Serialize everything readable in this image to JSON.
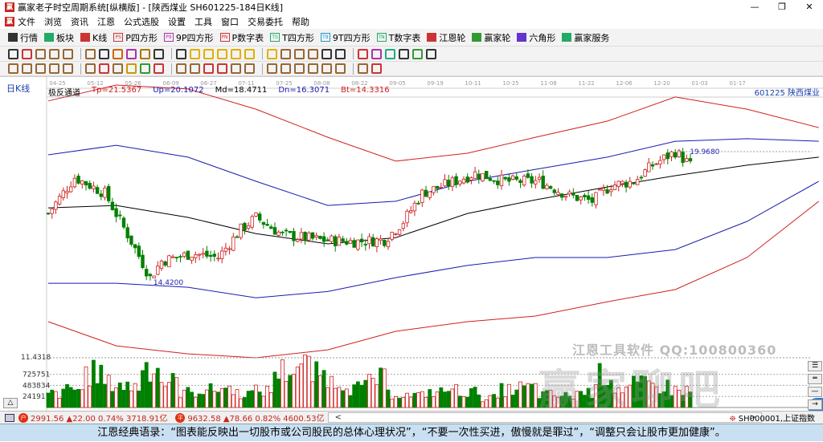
{
  "window": {
    "title": "赢家老子时空周期系统[纵横版] - [陕西煤业  SH601225-184日K线]",
    "controls": [
      "—",
      "❐",
      "✕"
    ]
  },
  "menu": [
    "文件",
    "浏览",
    "资讯",
    "江恩",
    "公式选股",
    "设置",
    "工具",
    "窗口",
    "交易委托",
    "帮助"
  ],
  "mdi_controls": [
    "_",
    "❐",
    "×"
  ],
  "toolbar": [
    {
      "label": "行情",
      "icon": "grid-icon",
      "color": "#333"
    },
    {
      "label": "板块",
      "icon": "blocks-icon",
      "color": "#2a6"
    },
    {
      "label": "K线",
      "icon": "candles-icon",
      "color": "#c33"
    },
    {
      "label": "P四方形",
      "icon": "PS",
      "color": "#c33"
    },
    {
      "label": "9P四方形",
      "icon": "P9",
      "color": "#a3a"
    },
    {
      "label": "P数字表",
      "icon": "PN",
      "color": "#c33"
    },
    {
      "label": "T四方形",
      "icon": "TS",
      "color": "#2a6"
    },
    {
      "label": "9T四方形",
      "icon": "T9",
      "color": "#29c"
    },
    {
      "label": "T数字表",
      "icon": "TN",
      "color": "#2a6"
    },
    {
      "label": "江恩轮",
      "icon": "wheel-icon",
      "color": "#c33"
    },
    {
      "label": "赢家轮",
      "icon": "wheel-icon",
      "color": "#393"
    },
    {
      "label": "六角形",
      "icon": "hexagon-icon",
      "color": "#63c"
    },
    {
      "label": "赢家服务",
      "icon": "dollar-icon",
      "color": "#2a6"
    }
  ],
  "toolbar2_colors": [
    "#333",
    "#c33",
    "#963",
    "#963",
    "#963",
    "#963",
    "#333",
    "#c60",
    "#a3a",
    "#a70",
    "#333",
    "#333",
    "#e0b000",
    "#e0b000",
    "#e0b000",
    "#e0b000",
    "#e0b000",
    "#e0b000",
    "#963",
    "#963",
    "#963",
    "#333",
    "#333",
    "#c33",
    "#a3a",
    "#2a8",
    "#333",
    "#393",
    "#333"
  ],
  "toolbar3_colors": [
    "#963",
    "#963",
    "#963",
    "#963",
    "#963",
    "#963",
    "#c33",
    "#963",
    "#c90",
    "#393",
    "#c33",
    "#963",
    "#963",
    "#c33",
    "#c33",
    "#963",
    "#963",
    "#963",
    "#963",
    "#963",
    "#963",
    "#963",
    "#963",
    "#963",
    "#c33"
  ],
  "chart": {
    "period_label": "日K线",
    "indicator": {
      "name": "极反通道",
      "tp": "Tp=21.5367",
      "up": "Up=20.1072",
      "md": "Md=18.4711",
      "dn": "Dn=16.3071",
      "bt": "Bt=14.3316"
    },
    "stock_label": "601225 陕西煤业",
    "colors": {
      "tp": "#d02020",
      "up": "#1a1ab0",
      "md": "#000000",
      "dn": "#1a1ab0",
      "bt": "#d02020",
      "up_candle": "#d02020",
      "down_candle": "#008000"
    },
    "low_marker": "14.4200",
    "high_marker": "19.9680",
    "lower_axis_label": "11.4318",
    "volume_ticks": [
      "725751",
      "483834",
      "241917"
    ],
    "watermark_text": "江恩工具软件  QQ:100800360",
    "watermark_logo": "赢家聊吧"
  },
  "chart_data": {
    "type": "candlestick",
    "x_tick_labels": [
      "04-25",
      "05-12",
      "05-26",
      "06-09",
      "06-27",
      "07-11",
      "07-25",
      "08-08",
      "08-22",
      "09-05",
      "09-19",
      "10-11",
      "10-25",
      "11-08",
      "11-22",
      "12-06",
      "12-20",
      "01-03",
      "01-17"
    ],
    "ylim": [
      11.0,
      22.98
    ],
    "channel_days": [
      0,
      18,
      37,
      55,
      74,
      92,
      111,
      129,
      148,
      166,
      185,
      204
    ],
    "series": [
      {
        "key": "tp",
        "values": [
          22.13,
          22.81,
          22.64,
          21.78,
          20.58,
          19.56,
          19.9,
          20.58,
          21.27,
          22.3,
          21.78,
          20.99
        ]
      },
      {
        "key": "up",
        "values": [
          19.83,
          20.24,
          19.73,
          18.7,
          17.67,
          17.85,
          18.7,
          19.21,
          19.73,
          20.41,
          20.52,
          20.41
        ]
      },
      {
        "key": "md",
        "values": [
          17.57,
          17.67,
          17.16,
          16.47,
          16.03,
          16.3,
          17.33,
          17.91,
          18.46,
          18.94,
          19.39,
          19.73
        ]
      },
      {
        "key": "dn",
        "values": [
          14.35,
          14.35,
          14.18,
          13.73,
          14.0,
          14.59,
          15.11,
          15.45,
          15.45,
          15.79,
          16.99,
          18.7
        ]
      },
      {
        "key": "bt",
        "values": [
          12.71,
          11.68,
          11.34,
          11.17,
          11.51,
          12.3,
          12.71,
          12.95,
          13.56,
          14.08,
          15.45,
          17.85
        ]
      }
    ],
    "close_days": [
      0,
      7,
      15,
      22,
      27,
      30,
      38,
      45,
      51,
      55,
      62,
      72,
      81,
      89,
      94,
      99,
      106,
      113,
      121,
      130,
      138,
      144,
      149,
      155,
      160,
      166,
      170
    ],
    "close_values": [
      17.33,
      18.87,
      18.19,
      16.13,
      14.59,
      15.3,
      15.62,
      15.45,
      16.65,
      17.16,
      16.41,
      16.2,
      16.13,
      16.2,
      16.99,
      18.19,
      18.6,
      19.04,
      18.7,
      18.7,
      18.08,
      17.85,
      18.53,
      18.7,
      19.39,
      19.97,
      19.39
    ],
    "volume_ylim": [
      0,
      1000000
    ],
    "volume_samples": [
      300000,
      400000,
      750000,
      520000,
      460000,
      900000,
      560000,
      330000,
      380000,
      420000,
      310000,
      360000,
      800000,
      900000,
      720000,
      560000,
      430000,
      620000,
      300000,
      260000,
      330000,
      380000,
      330000,
      210000,
      380000,
      430000,
      280000,
      250000,
      330000,
      700000,
      420000,
      500000,
      460000,
      380000,
      300000
    ]
  },
  "status": {
    "sh_index": "2991.56 ▲22.00 0.74% 3718.91亿",
    "sz_index": "9632.58 ▲78.66 0.82% 4600.53亿",
    "sh_icon": "户",
    "sz_icon": "平",
    "scroll_left": "<",
    "scroll_right": ">",
    "index_label": "SH000001,上证指数"
  },
  "quote": "江恩经典语录：“图表能反映出一切股市或公司股民的总体心理状况”，“不要一次性买进，傲慢就是罪过”，“调整只会让股市更加健康”。"
}
